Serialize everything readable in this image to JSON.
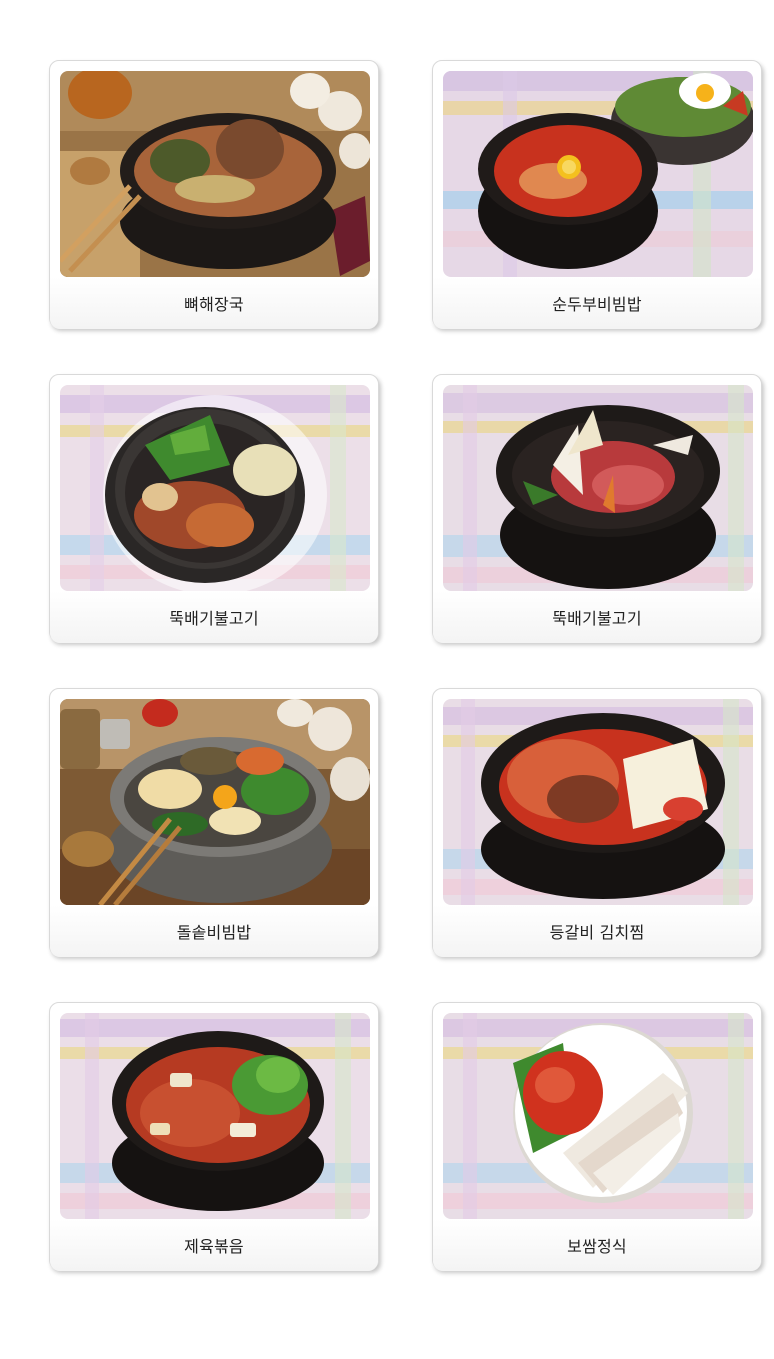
{
  "menu": {
    "items": [
      {
        "name": "뼈해장국",
        "photo": "bone-soup-photo"
      },
      {
        "name": "순두부비빔밥",
        "photo": "soft-tofu-stew-bibimbap-photo"
      },
      {
        "name": "뚝배기불고기",
        "photo": "earthen-pot-bibimbap-photo"
      },
      {
        "name": "뚝배기불고기",
        "photo": "earthen-pot-bulgogi-photo"
      },
      {
        "name": "돌솥비빔밥",
        "photo": "stone-pot-bibimbap-photo"
      },
      {
        "name": "등갈비 김치찜",
        "photo": "pork-rib-kimchi-stew-photo"
      },
      {
        "name": "제육볶음",
        "photo": "spicy-pork-stir-fry-photo"
      },
      {
        "name": "보쌈정식",
        "photo": "bossam-set-photo"
      }
    ]
  },
  "colors": {
    "card_border": "#d9d9d9",
    "caption_text": "#222222",
    "bowl_black": "#1e1a18",
    "stew_red": "#c8321e"
  }
}
